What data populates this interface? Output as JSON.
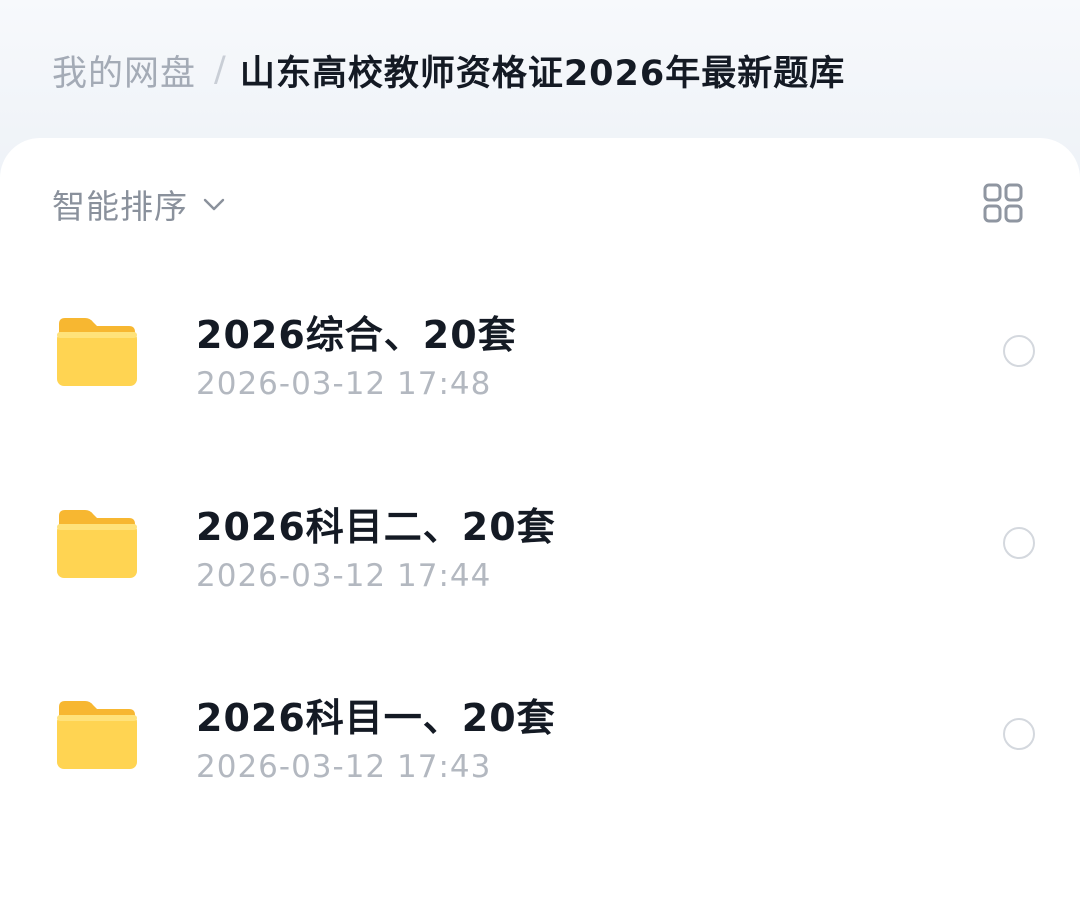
{
  "breadcrumb": {
    "root": "我的网盘",
    "separator": "/",
    "current": "山东高校教师资格证2026年最新题库"
  },
  "toolbar": {
    "sort_label": "智能排序",
    "sort_icon": "chevron-down-icon",
    "view_icon": "grid-view-icon"
  },
  "files": [
    {
      "name": "2026综合、20套",
      "date": "2026-03-12 17:48",
      "icon": "folder-icon"
    },
    {
      "name": "2026科目二、20套",
      "date": "2026-03-12 17:44",
      "icon": "folder-icon"
    },
    {
      "name": "2026科目一、20套",
      "date": "2026-03-12 17:43",
      "icon": "folder-icon"
    }
  ],
  "colors": {
    "folder": "#ffcf48",
    "title": "#141a24",
    "muted": "#a4abb6"
  }
}
